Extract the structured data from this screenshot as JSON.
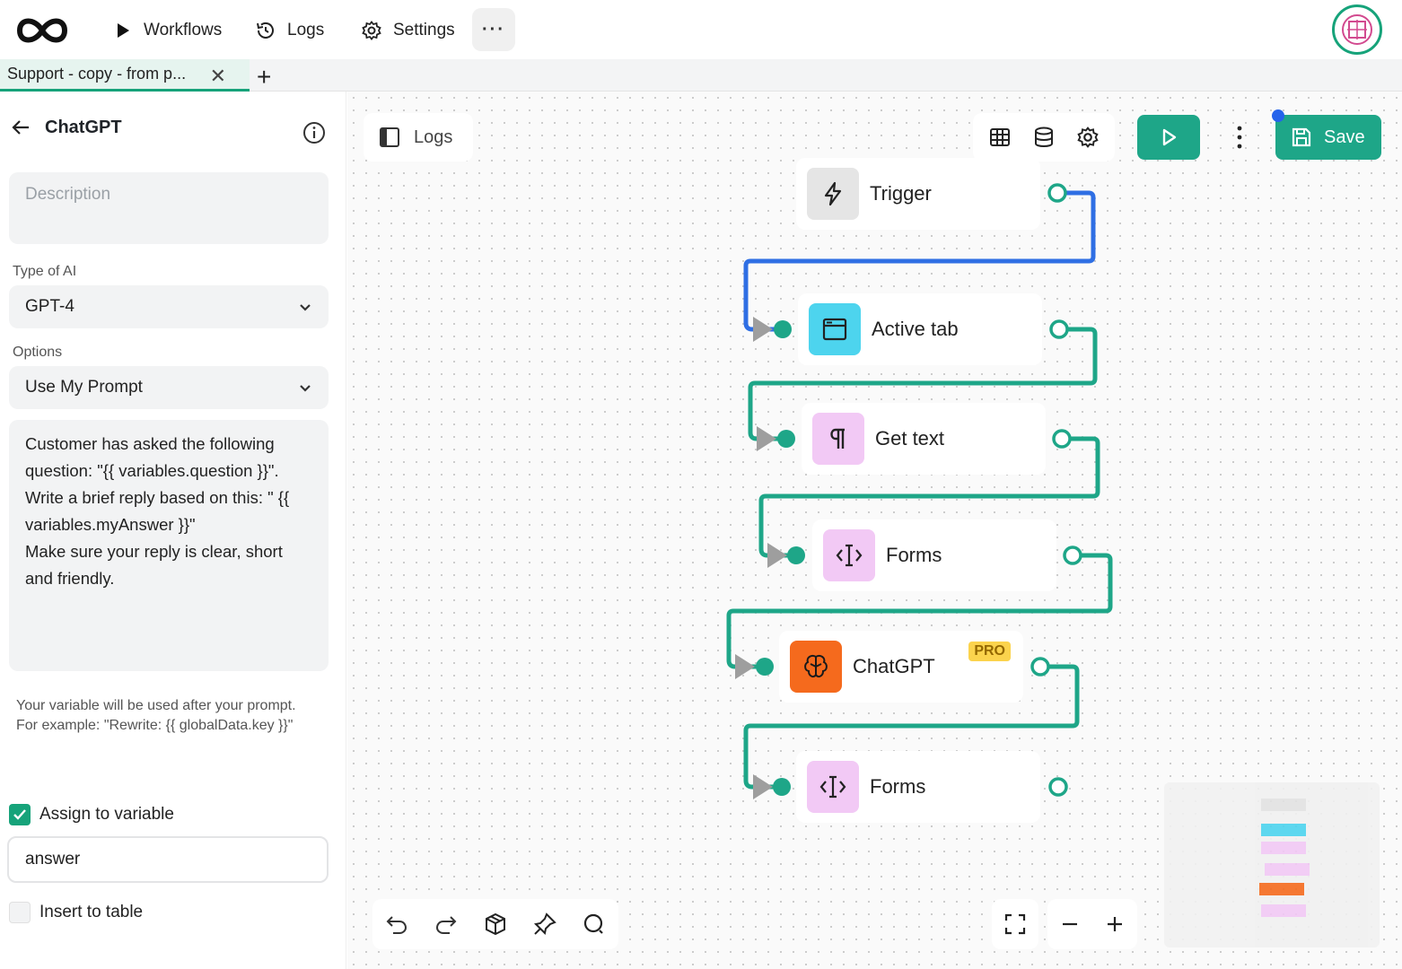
{
  "topbar": {
    "nav": [
      {
        "label": "Workflows",
        "icon": "play-icon"
      },
      {
        "label": "Logs",
        "icon": "history-icon"
      },
      {
        "label": "Settings",
        "icon": "gear-icon"
      }
    ],
    "more_label": "···"
  },
  "tabs": {
    "active_tab": "Support - copy - from p...",
    "close_label": "✕",
    "add_label": "+"
  },
  "sidebar": {
    "title": "ChatGPT",
    "description_placeholder": "Description",
    "type_label": "Type of AI",
    "type_value": "GPT-4",
    "options_label": "Options",
    "options_value": "Use My Prompt",
    "prompt": "Customer has asked the following question: \"{{ variables.question }}\". Write a brief reply based on this: \" {{ variables.myAnswer }}\"\nMake sure your reply is clear, short and friendly.",
    "hint": "Your variable will be used after your prompt.\nFor example: \"Rewrite: {{ globalData.key }}\"",
    "assign_label": "Assign to variable",
    "assign_checked": true,
    "variable_value": "answer",
    "insert_label": "Insert to table",
    "insert_checked": false
  },
  "canvas": {
    "logs_label": "Logs",
    "save_label": "Save",
    "accent": "#1ea688",
    "wire_active": "#2f6fe4",
    "nodes": [
      {
        "label": "Trigger",
        "icon": "lightning-icon",
        "color": "#e5e5e5"
      },
      {
        "label": "Active tab",
        "icon": "browser-window-icon",
        "color": "#4dd4ee"
      },
      {
        "label": "Get text",
        "icon": "paragraph-icon",
        "color": "#f2c9f5"
      },
      {
        "label": "Forms",
        "icon": "text-cursor-icon",
        "color": "#f2c9f5"
      },
      {
        "label": "ChatGPT",
        "icon": "brain-icon",
        "color": "#f56a1d",
        "badge": "PRO"
      },
      {
        "label": "Forms",
        "icon": "text-cursor-icon",
        "color": "#f2c9f5"
      }
    ]
  }
}
